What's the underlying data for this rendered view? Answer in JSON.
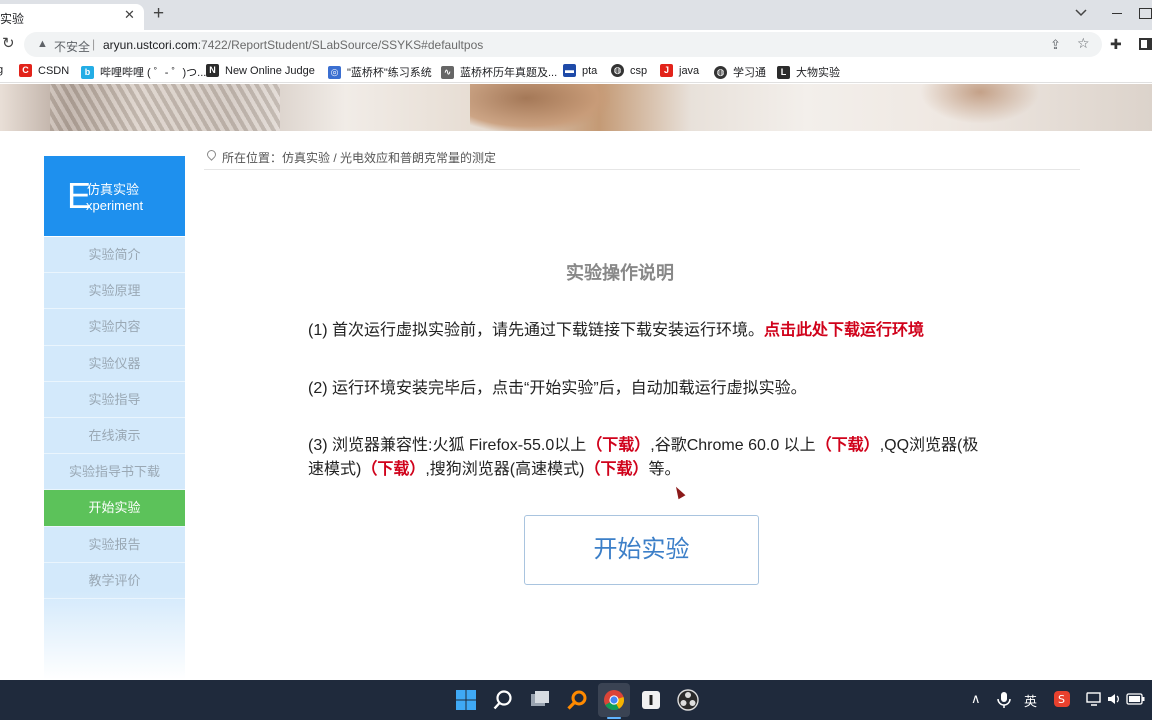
{
  "browser": {
    "tab_title": "实验",
    "tab_close": "✕",
    "new_tab": "+",
    "address": {
      "insecure_label": "不安全",
      "separator": "|",
      "url_host": "aryun.ustcori.com",
      "url_rest": ":7422/ReportStudent/SLabSource/SSYKS#defaultpos"
    },
    "bookmarks": [
      {
        "label": "CSDN",
        "icon": "C",
        "color": "#e2231a"
      },
      {
        "label": "哔哩哔哩 ( ゜- ゜)つ...",
        "icon": "b",
        "color": "#23ade5"
      },
      {
        "label": "New Online Judge",
        "icon": "N",
        "color": "#2b2b2b"
      },
      {
        "label": "\"蓝桥杯\"练习系统",
        "icon": "◎",
        "color": "#3b6fd1"
      },
      {
        "label": "蓝桥杯历年真题及...",
        "icon": "∿",
        "color": "#555555"
      },
      {
        "label": "pta",
        "icon": "▬",
        "color": "#1e4aa8"
      },
      {
        "label": "csp",
        "icon": "◍",
        "color": "#333333"
      },
      {
        "label": "java",
        "icon": "J",
        "color": "#e2231a"
      },
      {
        "label": "学习通",
        "icon": "◍",
        "color": "#333333"
      },
      {
        "label": "大物实验",
        "icon": "L",
        "color": "#2b2b2b"
      }
    ]
  },
  "sidebar": {
    "header_letter": "E",
    "header_cn": "仿真实验",
    "header_en": "xperiment",
    "items": [
      {
        "label": "实验简介",
        "active": false
      },
      {
        "label": "实验原理",
        "active": false
      },
      {
        "label": "实验内容",
        "active": false
      },
      {
        "label": "实验仪器",
        "active": false
      },
      {
        "label": "实验指导",
        "active": false
      },
      {
        "label": "在线演示",
        "active": false
      },
      {
        "label": "实验指导书下载",
        "active": false
      },
      {
        "label": "开始实验",
        "active": true
      },
      {
        "label": "实验报告",
        "active": false
      },
      {
        "label": "教学评价",
        "active": false
      }
    ]
  },
  "breadcrumb": "所在位置：仿真实验 / 光电效应和普朗克常量的测定",
  "main": {
    "title": "实验操作说明",
    "p1_text": "(1) 首次运行虚拟实验前，请先通过下载链接下载安装运行环境。",
    "p1_link": "点击此处下载运行环境",
    "p2_text": "(2) 运行环境安装完毕后，点击“开始实验”后，自动加载运行虚拟实验。",
    "p3_a": "(3) 浏览器兼容性:火狐 Firefox-55.0以上",
    "p3_dl1": "（下载）",
    "p3_b": ",谷歌Chrome 60.0 以上",
    "p3_dl2": "（下载）",
    "p3_c": ",QQ浏览器(极速模式)",
    "p3_dl3": "（下载）",
    "p3_d": ",搜狗浏览器(高速模式)",
    "p3_dl4": "（下载）",
    "p3_e": "等。",
    "start_button": "开始实验"
  },
  "taskbar": {
    "tray_ime": "英",
    "tray_up": "∧"
  }
}
